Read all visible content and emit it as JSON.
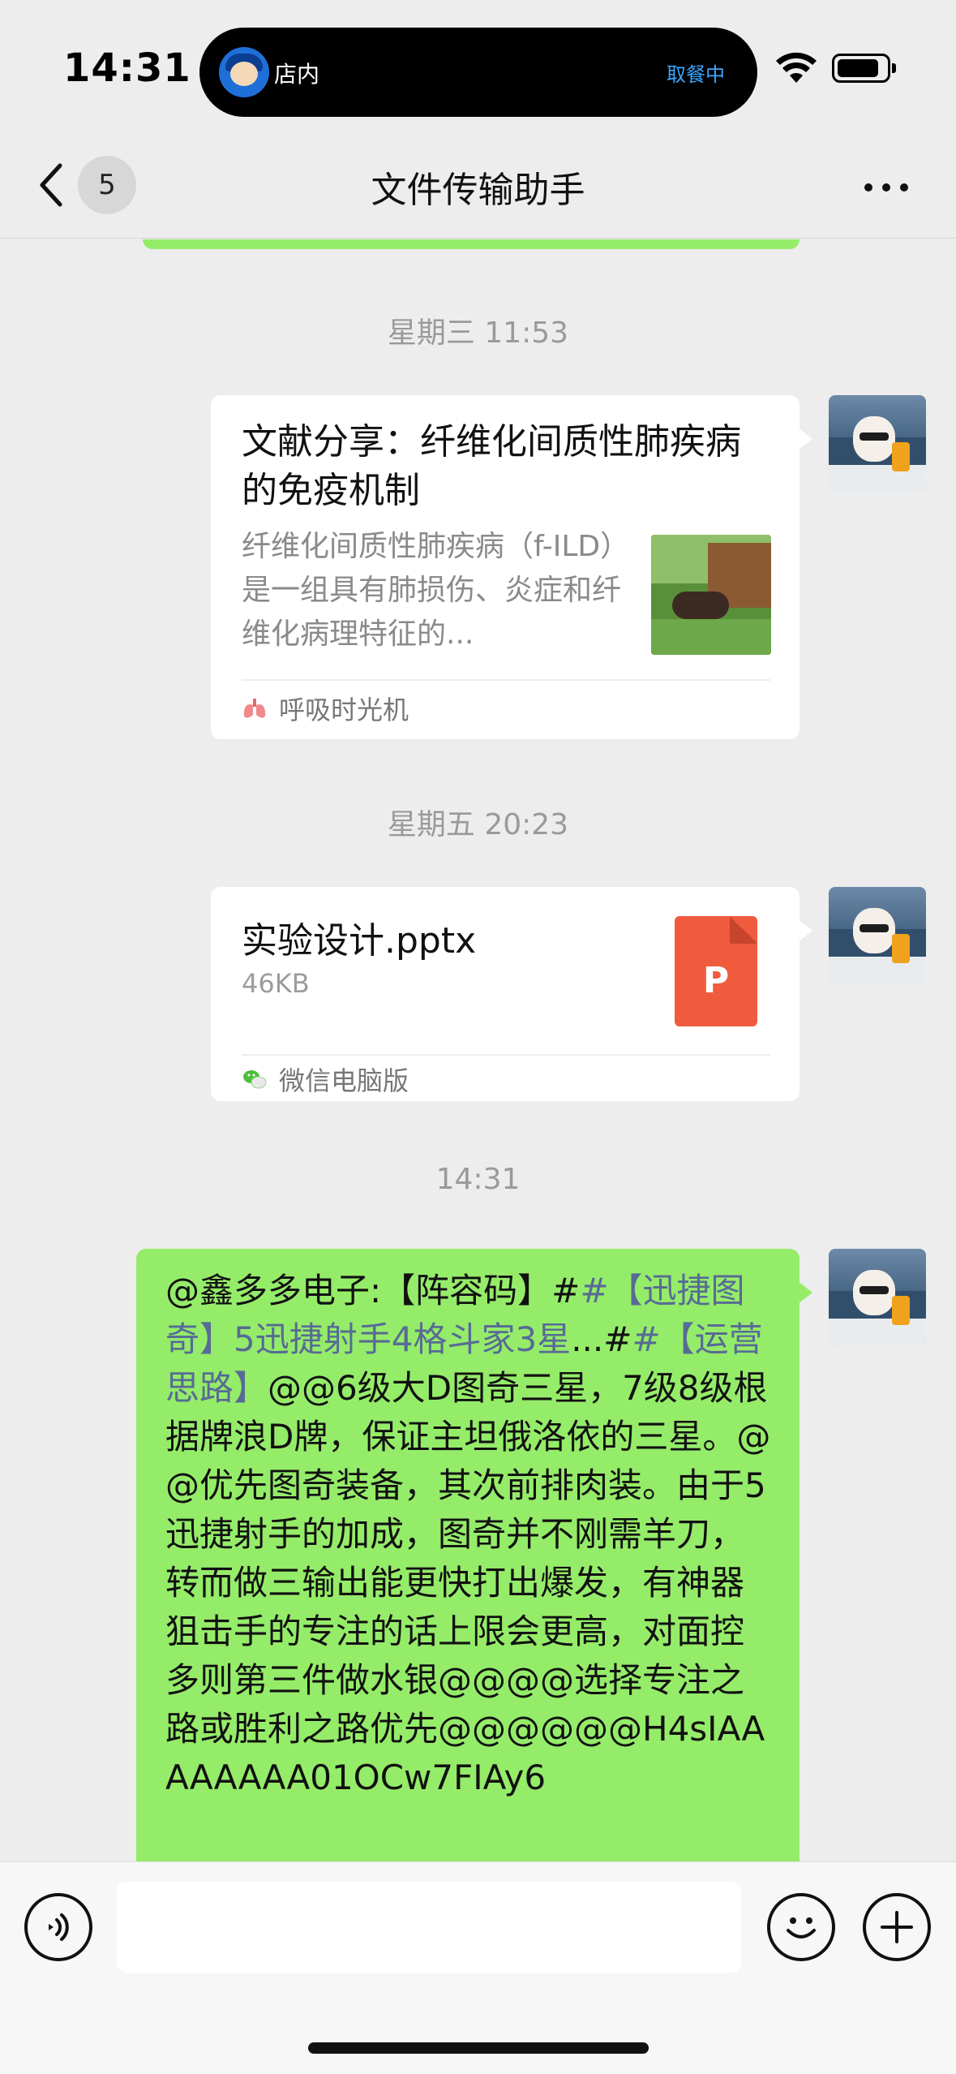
{
  "status_bar": {
    "time": "14:31",
    "island_label": "店内",
    "island_status": "取餐中"
  },
  "nav": {
    "unread_count": "5",
    "title": "文件传输助手"
  },
  "messages": [
    {
      "type": "timestamp",
      "text": "星期三 11:53"
    },
    {
      "type": "article",
      "title": "文献分享：纤维化间质性肺疾病的免疫机制",
      "description": "纤维化间质性肺疾病（f-ILD）是一组具有肺损伤、炎症和纤维化病理特征的...",
      "source": "呼吸时光机",
      "source_icon": "lungs-icon"
    },
    {
      "type": "timestamp",
      "text": "星期五 20:23"
    },
    {
      "type": "file",
      "name": "实验设计.pptx",
      "size": "46KB",
      "file_icon_letter": "P",
      "source": "微信电脑版",
      "source_icon": "wechat-icon"
    },
    {
      "type": "timestamp",
      "text": "14:31"
    },
    {
      "type": "text",
      "parts": {
        "p1": "@鑫多多电子:【阵容码】#",
        "tag1": "#【迅捷图奇】",
        "p2": "",
        "tag2": "5迅捷射手4格斗家3星",
        "p3": "...#",
        "tag3": "#【运营思路】",
        "p4": "@@6级大D图奇三星，7级8级根据牌浪D牌，保证主坦俄洛依的三星。@@优先图奇装备，其次前排肉装。由于5迅捷射手的加成，图奇并不刚需羊刀，转而做三输出能更快打出爆发，有神器狙击手的专注的话上限会更高，对面控多则第三件做水银@@@@选择专注之路或胜利之路优先@@@@@@H4sIAAAAAAAA01OCw7FIAy6"
      }
    }
  ],
  "colors": {
    "background": "#ededed",
    "bubble_self": "#95ec69",
    "link": "#576b95",
    "timestamp": "#9a9a9a",
    "ppt": "#f05b3e"
  }
}
